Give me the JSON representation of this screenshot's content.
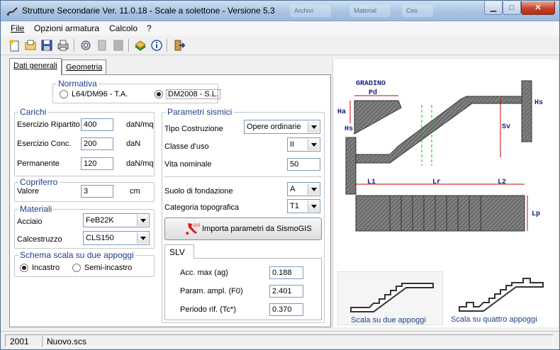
{
  "window": {
    "title": "Strutture Secondarie Ver. 11.0.18 - Scale a solettone - Versione 5.3",
    "ghost_items": [
      "Archivi",
      "Material",
      "Ces"
    ],
    "minimize_glyph": "▁",
    "maximize_glyph": "□",
    "close_glyph": "✕"
  },
  "menu": {
    "items": [
      {
        "label": "File"
      },
      {
        "label": "Opzioni armatura"
      },
      {
        "label": "Calcolo"
      },
      {
        "label": "?"
      }
    ]
  },
  "toolbar": {
    "icons": [
      "new-file-icon",
      "open-folder-icon",
      "save-icon",
      "print-icon",
      "settings-icon",
      "page-icon",
      "page-gray-icon",
      "book-icon",
      "info-icon",
      "exit-icon"
    ]
  },
  "tabs": [
    {
      "label": "Dati generali",
      "active": true
    },
    {
      "label": "Geometria",
      "active": false
    }
  ],
  "normativa": {
    "title": "Normativa",
    "options": [
      {
        "label": "L64/DM96 - T.A.",
        "selected": false
      },
      {
        "label": "DM2008 - S.L.",
        "selected": true
      }
    ]
  },
  "carichi": {
    "title": "Carichi",
    "rows": [
      {
        "label": "Esercizio Ripartito",
        "value": "400",
        "unit": "daN/mq"
      },
      {
        "label": "Esercizio Conc.",
        "value": "200",
        "unit": "daN"
      },
      {
        "label": "Permanente",
        "value": "120",
        "unit": "daN/mq"
      }
    ]
  },
  "copriferro": {
    "title": "Copriferro",
    "label": "Valore",
    "value": "3",
    "unit": "cm"
  },
  "materiali": {
    "title": "Materiali",
    "acciaio_label": "Acciaio",
    "acciaio_value": "FeB22K",
    "calcestruzzo_label": "Calcestruzzo",
    "calcestruzzo_value": "CLS150"
  },
  "schema": {
    "title": "Schema scala su due appoggi",
    "options": [
      {
        "label": "Incastro",
        "selected": true
      },
      {
        "label": "Semi-incastro",
        "selected": false
      }
    ]
  },
  "sismici": {
    "title": "Parametri sismici",
    "tipo_label": "Tipo Costruzione",
    "tipo_value": "Opere ordinarie",
    "classe_label": "Classe d'uso",
    "classe_value": "II",
    "vita_label": "Vita nominale",
    "vita_value": "50",
    "suolo_label": "Suolo di fondazione",
    "suolo_value": "A",
    "categoria_label": "Categoria topografica",
    "categoria_value": "T1",
    "import_button": "Importa parametri da SismoGIS",
    "import_logo_text": "GIS",
    "slv_tab": "SLV",
    "acc_label": "Acc. max (ag)",
    "acc_value": "0.188",
    "f0_label": "Param. ampl.  (F0)",
    "f0_value": "2.401",
    "tc_label": "Periodo rif.  (Tc*)",
    "tc_value": "0.370"
  },
  "diagram": {
    "gradino": "GRADINO",
    "pd": "Pd",
    "ha": "Ha",
    "hs_left": "Hs",
    "hs_right": "Hs",
    "sv": "Sv",
    "l1": "L1",
    "lr": "Lr",
    "l2": "L2",
    "lp": "Lp"
  },
  "scheme_options": [
    {
      "label": "Scala su due appoggi",
      "selected": true
    },
    {
      "label": "Scala su quattro appoggi",
      "selected": false
    }
  ],
  "status": {
    "year": "2001",
    "file": "Nuovo.scs"
  },
  "colors": {
    "group_title": "#1d3f8a",
    "diagram_blue": "#1a237e",
    "dimension_red": "#cc0000",
    "hatch_green": "#00c000",
    "concrete": "#6e6e6e"
  }
}
